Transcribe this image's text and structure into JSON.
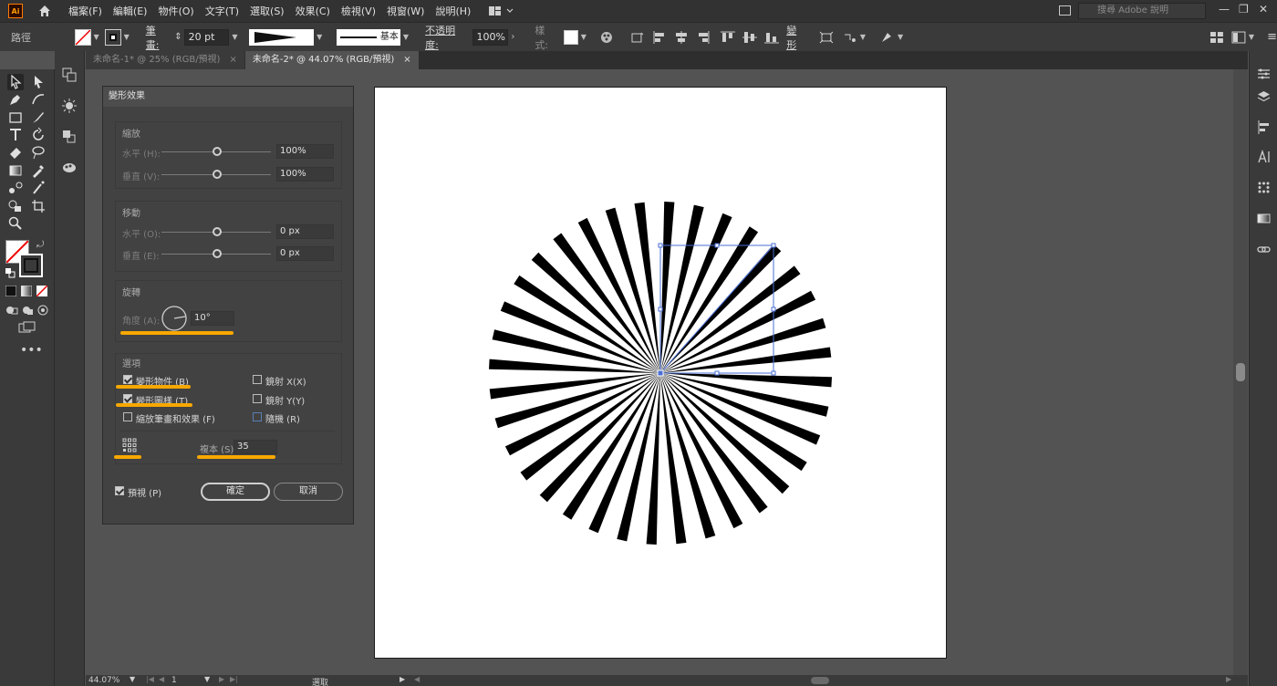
{
  "app": {
    "logo_text": "Ai"
  },
  "menu": [
    "檔案(F)",
    "編輯(E)",
    "物件(O)",
    "文字(T)",
    "選取(S)",
    "效果(C)",
    "檢視(V)",
    "視窗(W)",
    "說明(H)"
  ],
  "search": {
    "placeholder": "搜尋 Adobe 說明"
  },
  "control_bar": {
    "selection_label": "路徑",
    "stroke_label": "筆畫:",
    "stroke_weight": "20 pt",
    "profile_label": "基本",
    "opacity_label": "不透明度:",
    "opacity_value": "100%",
    "style_label": "樣式:",
    "transform_label": "變形"
  },
  "tabs": [
    {
      "title": "未命名-1* @ 25% (RGB/預視)",
      "close": "×",
      "active": false
    },
    {
      "title": "未命名-2* @ 44.07% (RGB/預視)",
      "close": "×",
      "active": true
    }
  ],
  "dialog": {
    "title": "變形效果",
    "scale": {
      "title": "縮放",
      "horizontal_label": "水平 (H):",
      "horizontal_value": "100%",
      "vertical_label": "垂直 (V):",
      "vertical_value": "100%"
    },
    "move": {
      "title": "移動",
      "horizontal_label": "水平 (O):",
      "horizontal_value": "0 px",
      "vertical_label": "垂直 (E):",
      "vertical_value": "0 px"
    },
    "rotate": {
      "title": "旋轉",
      "angle_label": "角度 (A):",
      "angle_value": "10°"
    },
    "options": {
      "title": "選項",
      "transform_objects": {
        "label": "變形物件 (B)",
        "checked": true
      },
      "transform_patterns": {
        "label": "變形圖樣 (T)",
        "checked": true
      },
      "scale_strokes": {
        "label": "縮放筆畫和效果 (F)",
        "checked": false
      },
      "reflect_x": {
        "label": "鏡射 X(X)",
        "checked": false
      },
      "reflect_y": {
        "label": "鏡射 Y(Y)",
        "checked": false
      },
      "random": {
        "label": "隨機 (R)",
        "checked": false
      },
      "copies_label": "複本 (S)",
      "copies_value": "35"
    },
    "preview": {
      "label": "預視 (P)",
      "checked": true
    },
    "ok_label": "確定",
    "cancel_label": "取消"
  },
  "status_bar": {
    "zoom": "44.07%",
    "artboard_number": "1",
    "tool_label": "選取"
  },
  "artwork": {
    "ray_count": 36,
    "rotation_step_deg": 10,
    "fill_color": "#000000"
  },
  "colors": {
    "highlight": "#f7a800",
    "selection": "#4a6fd6"
  }
}
